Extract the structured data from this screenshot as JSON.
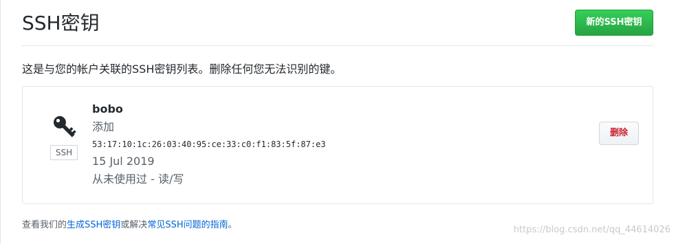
{
  "header": {
    "title": "SSH密钥",
    "new_key_label": "新的SSH密钥"
  },
  "intro": {
    "text": "这是与您的帐户关联的SSH密钥列表。删除任何您无法识别的键。"
  },
  "keys": [
    {
      "icon": "key-icon",
      "badge": "SSH",
      "title": "bobo",
      "added_label": "添加",
      "fingerprint": "53:17:10:1c:26:03:40:95:ce:33:c0:f1:83:5f:87:e3",
      "date": "15 Jul 2019",
      "usage": "从未使用过 - 读/写",
      "delete_label": "删除"
    }
  ],
  "footer": {
    "prefix": "查看我们的",
    "link1": "生成SSH密钥",
    "middle": "或解决",
    "link2": "常见SSH问题的指南",
    "suffix": "。"
  },
  "watermark": "https://blog.csdn.net/qq_44614026",
  "colors": {
    "primary_button": "#28a745",
    "danger_text": "#cb2431",
    "link": "#0366d6"
  }
}
